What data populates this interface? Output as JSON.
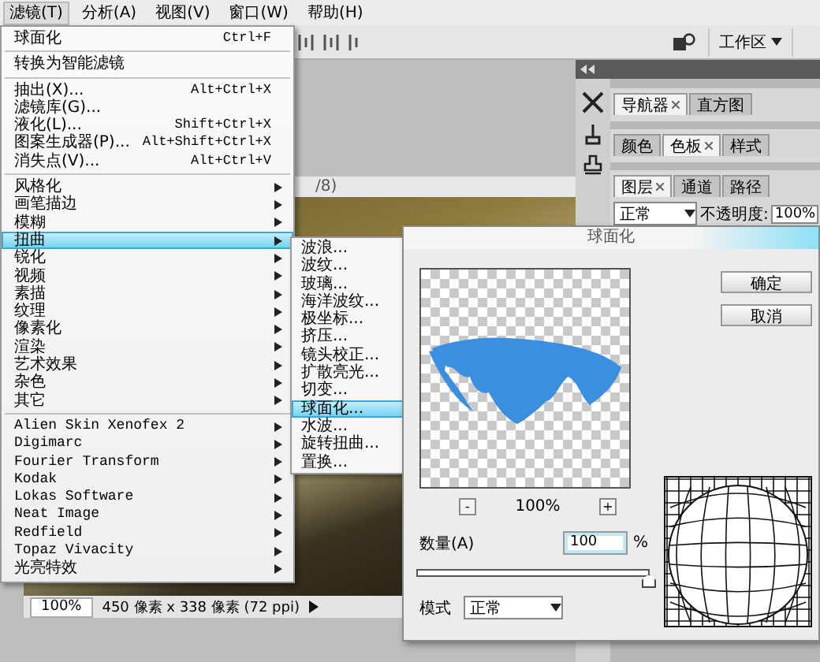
{
  "menubar": [
    {
      "label": "滤镜(T)",
      "selected": true
    },
    {
      "label": "分析(A)",
      "selected": false
    },
    {
      "label": "视图(V)",
      "selected": false
    },
    {
      "label": "窗口(W)",
      "selected": false
    },
    {
      "label": "帮助(H)",
      "selected": false
    }
  ],
  "options_bar": {
    "workspace_button": "工作区"
  },
  "document": {
    "title": "/8)",
    "zoom": "100%",
    "info": "450 像素 x 338 像素 (72 ppi)"
  },
  "panels": [
    {
      "tabs": [
        {
          "label": "导航器",
          "selected": true
        },
        {
          "label": "直方图",
          "selected": false
        }
      ]
    },
    {
      "tabs": [
        {
          "label": "颜色",
          "selected": false
        },
        {
          "label": "色板",
          "selected": true
        },
        {
          "label": "样式",
          "selected": false
        }
      ]
    },
    {
      "tabs": [
        {
          "label": "图层",
          "selected": true
        },
        {
          "label": "通道",
          "selected": false
        },
        {
          "label": "路径",
          "selected": false
        }
      ]
    }
  ],
  "layers_controls": {
    "blend_mode": "正常",
    "opacity_label": "不透明度:",
    "opacity_value": "100%"
  },
  "filter_menu": {
    "groups": [
      [
        {
          "label": "球面化",
          "shortcut": "Ctrl+F",
          "submenu": false,
          "selected": false
        }
      ],
      [
        {
          "label": "转换为智能滤镜",
          "submenu": false,
          "selected": false
        }
      ],
      [
        {
          "label": "抽出(X)...",
          "shortcut": "Alt+Ctrl+X",
          "submenu": false,
          "selected": false
        },
        {
          "label": "滤镜库(G)...",
          "submenu": false,
          "selected": false
        },
        {
          "label": "液化(L)...",
          "shortcut": "Shift+Ctrl+X",
          "submenu": false,
          "selected": false
        },
        {
          "label": "图案生成器(P)...",
          "shortcut": "Alt+Shift+Ctrl+X",
          "submenu": false,
          "selected": false
        },
        {
          "label": "消失点(V)...",
          "shortcut": "Alt+Ctrl+V",
          "submenu": false,
          "selected": false
        }
      ],
      [
        {
          "label": "风格化",
          "submenu": true,
          "selected": false
        },
        {
          "label": "画笔描边",
          "submenu": true,
          "selected": false
        },
        {
          "label": "模糊",
          "submenu": true,
          "selected": false
        },
        {
          "label": "扭曲",
          "submenu": true,
          "selected": true
        },
        {
          "label": "锐化",
          "submenu": true,
          "selected": false
        },
        {
          "label": "视频",
          "submenu": true,
          "selected": false
        },
        {
          "label": "素描",
          "submenu": true,
          "selected": false
        },
        {
          "label": "纹理",
          "submenu": true,
          "selected": false
        },
        {
          "label": "像素化",
          "submenu": true,
          "selected": false
        },
        {
          "label": "渲染",
          "submenu": true,
          "selected": false
        },
        {
          "label": "艺术效果",
          "submenu": true,
          "selected": false
        },
        {
          "label": "杂色",
          "submenu": true,
          "selected": false
        },
        {
          "label": "其它",
          "submenu": true,
          "selected": false
        }
      ],
      [
        {
          "label": "Alien Skin Xenofex 2",
          "submenu": true,
          "selected": false
        },
        {
          "label": "Digimarc",
          "submenu": true,
          "selected": false
        },
        {
          "label": "Fourier Transform",
          "submenu": true,
          "selected": false
        },
        {
          "label": "Kodak",
          "submenu": true,
          "selected": false
        },
        {
          "label": "Lokas Software",
          "submenu": true,
          "selected": false
        },
        {
          "label": "Neat Image",
          "submenu": true,
          "selected": false
        },
        {
          "label": "Redfield",
          "submenu": true,
          "selected": false
        },
        {
          "label": "Topaz Vivacity",
          "submenu": true,
          "selected": false
        },
        {
          "label": "光亮特效",
          "submenu": true,
          "selected": false
        }
      ]
    ]
  },
  "distort_submenu": [
    {
      "label": "波浪...",
      "selected": false
    },
    {
      "label": "波纹...",
      "selected": false
    },
    {
      "label": "玻璃...",
      "selected": false
    },
    {
      "label": "海洋波纹...",
      "selected": false
    },
    {
      "label": "极坐标...",
      "selected": false
    },
    {
      "label": "挤压...",
      "selected": false
    },
    {
      "label": "镜头校正...",
      "selected": false
    },
    {
      "label": "扩散亮光...",
      "selected": false
    },
    {
      "label": "切变...",
      "selected": false
    },
    {
      "label": "球面化...",
      "selected": true
    },
    {
      "label": "水波...",
      "selected": false
    },
    {
      "label": "旋转扭曲...",
      "selected": false
    },
    {
      "label": "置换...",
      "selected": false
    }
  ],
  "dialog": {
    "title": "球面化",
    "buttons": [
      "确定",
      "取消"
    ],
    "zoom": {
      "minus": "-",
      "value": "100%",
      "plus": "+"
    },
    "amount": {
      "label": "数量(A)",
      "value": "100",
      "unit": "%",
      "level": 1
    },
    "mode": {
      "label": "模式",
      "value": "正常"
    }
  }
}
